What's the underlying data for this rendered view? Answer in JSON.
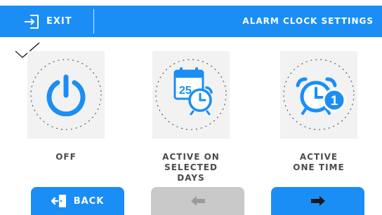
{
  "header": {
    "exit_label": "EXIT",
    "title": "ALARM CLOCK SETTINGS",
    "icon": "exit-icon"
  },
  "colors": {
    "accent": "#1a8ef5",
    "card_bg": "#f2f2f2",
    "disabled": "#c9c9c9",
    "label_text": "#4b4b4b"
  },
  "options": [
    {
      "id": "off",
      "line1": "OFF",
      "line2": "",
      "icon": "power-icon",
      "selected": true
    },
    {
      "id": "selected-days",
      "line1": "ACTIVE ON",
      "line2": "SELECTED DAYS",
      "icon": "calendar-alarm-icon",
      "calendar_number": "25",
      "selected": false
    },
    {
      "id": "one-time",
      "line1": "ACTIVE",
      "line2": "ONE TIME",
      "icon": "alarm-once-icon",
      "badge_number": "1",
      "selected": false
    }
  ],
  "nav": {
    "back_label": "BACK",
    "back_icon": "back-door-icon",
    "prev_icon": "arrow-left-icon",
    "prev_enabled": false,
    "next_icon": "arrow-right-icon",
    "next_enabled": true
  }
}
